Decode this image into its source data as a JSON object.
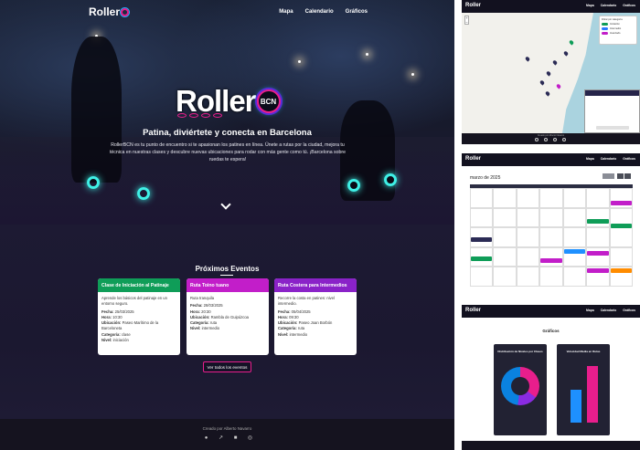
{
  "nav": {
    "brand": "Roller",
    "links": [
      "Mapa",
      "Calendario",
      "Gráficos"
    ]
  },
  "hero": {
    "brand": "Roller",
    "badge": "BCN",
    "tagline": "Patina, diviértete y conecta en Barcelona",
    "description": "RollerBCN es tu punto de encuentro si te apasionan los patines en línea. Únete a rutas por la ciudad, mejora tu técnica en nuestras clases y descubre nuevas ubicaciones para rodar con más gente como tú. ¡Barcelona sobre ruedas te espera!"
  },
  "events": {
    "title": "Próximos Eventos",
    "button": "Ver todos los eventos",
    "cards": [
      {
        "title": "Clase de Iniciación al Patinaje",
        "color": "#0f9d58",
        "desc": "Aprende los básicos del patinaje en un entorno seguro.",
        "fecha_label": "Fecha:",
        "fecha": "25/03/2025",
        "hora_label": "Hora:",
        "hora": "10:30",
        "ubic_label": "Ubicación:",
        "ubic": "Paseo Marítimo de la Barceloneta",
        "cat_label": "Categoría:",
        "cat": "clase",
        "nivel_label": "Nivel:",
        "nivel": "iniciación"
      },
      {
        "title": "Ruta Toino tuano",
        "color": "#c21ec9",
        "desc": "Ruta tranquila",
        "fecha_label": "Fecha:",
        "fecha": "28/03/2025",
        "hora_label": "Hora:",
        "hora": "20:30",
        "ubic_label": "Ubicación:",
        "ubic": "Rambla de Guipúzcoa",
        "cat_label": "Categoría:",
        "cat": "ruta",
        "nivel_label": "Nivel:",
        "nivel": "intermedio"
      },
      {
        "title": "Ruta Costera para Intermedios",
        "color": "#8a22c8",
        "desc": "Recorre la costa en patines: nivel intermedio.",
        "fecha_label": "Fecha:",
        "fecha": "05/04/2025",
        "hora_label": "Hora:",
        "hora": "09:30",
        "ubic_label": "Ubicación:",
        "ubic": "Paseo Joan Borbón",
        "cat_label": "Categoría:",
        "cat": "ruta",
        "nivel_label": "Nivel:",
        "nivel": "intermedio"
      }
    ]
  },
  "footer": {
    "text": "Creado por Alberto Navarro"
  },
  "thumb_map": {
    "legend_title": "Filtrar por categoría",
    "legend": [
      "Iniciación",
      "Intermedio",
      "Avanzado"
    ]
  },
  "thumb_calendar": {
    "title": "marzo de 2025"
  },
  "thumb_charts": {
    "title": "Gráficos",
    "panels": [
      "Distribución de Niveles por Clases",
      "Velocidad Media en Rutas"
    ]
  },
  "colors": {
    "accent": "#e81e8c",
    "blue": "#22b0ff",
    "dark": "#1b1730"
  }
}
